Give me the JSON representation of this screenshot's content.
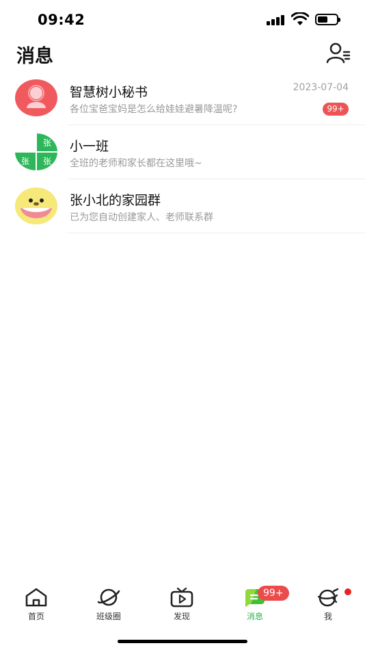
{
  "status_bar": {
    "time": "09:42"
  },
  "header": {
    "title": "消息"
  },
  "conversations": [
    {
      "name": "智慧树小秘书",
      "preview": "各位宝爸宝妈是怎么给娃娃避暑降温呢?",
      "time": "2023-07-04",
      "badge": "99+",
      "avatar": "secretary-avatar"
    },
    {
      "name": "小一班",
      "preview": "全班的老师和家长都在这里哦~",
      "avatar": "class-group-avatar",
      "avatar_text": [
        "张",
        "张",
        "张"
      ]
    },
    {
      "name": "张小北的家园群",
      "preview": "已为您自动创建家人、老师联系群",
      "avatar": "family-group-avatar"
    }
  ],
  "tabs": [
    {
      "label": "首页",
      "icon": "home-icon"
    },
    {
      "label": "班级圈",
      "icon": "planet-icon"
    },
    {
      "label": "发现",
      "icon": "tv-play-icon"
    },
    {
      "label": "消息",
      "icon": "message-icon",
      "active": true,
      "badge": "99+"
    },
    {
      "label": "我",
      "icon": "profile-planet-icon",
      "dot": true
    }
  ],
  "colors": {
    "accent_green": "#27b34a",
    "badge_red": "#ec4b4b",
    "secretary_avatar": "#f05a5f",
    "family_avatar": "#f6e97a"
  }
}
